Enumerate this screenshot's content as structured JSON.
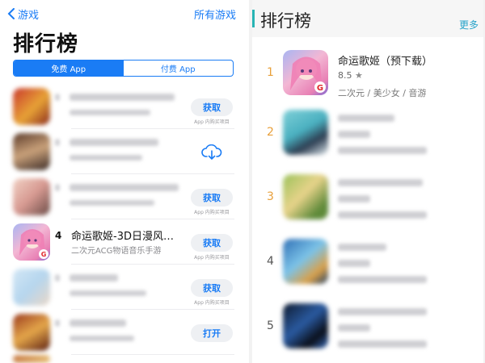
{
  "left": {
    "back_label": "游戏",
    "all_games_label": "所有游戏",
    "title": "排行榜",
    "tabs": [
      {
        "label": "免费 App",
        "active": true
      },
      {
        "label": "付费 App",
        "active": false
      }
    ],
    "rows": [
      {
        "rank": "",
        "name": "",
        "subtitle": "",
        "action": "获取",
        "iap_note": "App 内购买项目",
        "blurred": true
      },
      {
        "rank": "",
        "name": "",
        "subtitle": "",
        "action": "cloud-download",
        "iap_note": "",
        "blurred": true
      },
      {
        "rank": "",
        "name": "",
        "subtitle": "",
        "action": "获取",
        "iap_note": "App 内购买项目",
        "blurred": true
      },
      {
        "rank": "4",
        "name": "命运歌姬-3D日漫风音乐…",
        "subtitle": "二次元ACG物语音乐手游",
        "action": "获取",
        "iap_note": "App 内购买项目",
        "blurred": false
      },
      {
        "rank": "",
        "name": "",
        "subtitle": "",
        "action": "获取",
        "iap_note": "App 内购买项目",
        "blurred": true
      },
      {
        "rank": "",
        "name": "",
        "subtitle": "",
        "action": "打开",
        "iap_note": "",
        "blurred": true
      }
    ],
    "accent_color": "#1a7cf5"
  },
  "right": {
    "title": "排行榜",
    "more_label": "更多",
    "accent_color": "#27b4b4",
    "rank_color_top": "#e8a03a",
    "rank_color_rest": "#555555",
    "items": [
      {
        "rank": "1",
        "name": "命运歌姬（预下载）",
        "score": "8.5",
        "tags": "二次元 / 美少女 / 音游",
        "blurred": false
      },
      {
        "rank": "2",
        "name": "",
        "score": "",
        "tags": "",
        "blurred": true
      },
      {
        "rank": "3",
        "name": "",
        "score": "",
        "tags": "",
        "blurred": true
      },
      {
        "rank": "4",
        "name": "",
        "score": "",
        "tags": "",
        "blurred": true
      },
      {
        "rank": "5",
        "name": "",
        "score": "",
        "tags": "",
        "blurred": true
      }
    ]
  }
}
